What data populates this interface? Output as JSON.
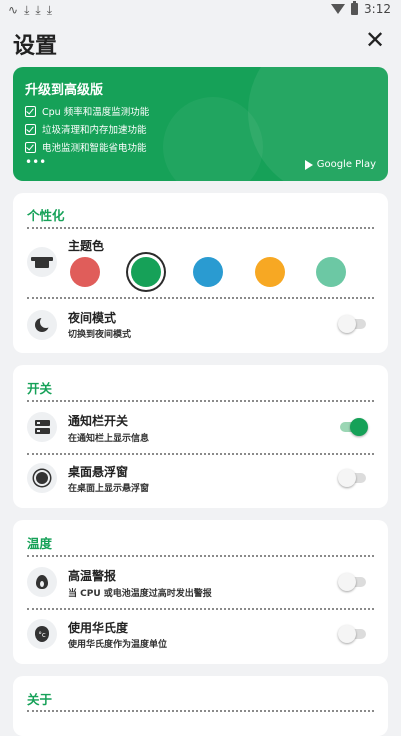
{
  "status_bar": {
    "time": "3:12"
  },
  "header": {
    "title": "设置",
    "close_label": "✕"
  },
  "promo": {
    "title": "升级到高级版",
    "features": [
      "Cpu 频率和温度监测功能",
      "垃圾清理和内存加速功能",
      "电池监测和智能省电功能"
    ],
    "more": "•••",
    "store": "Google Play"
  },
  "personalization": {
    "title": "个性化",
    "theme": {
      "label": "主题色",
      "colors": [
        "#e05d5a",
        "#16a158",
        "#2a9bd1",
        "#f7a823",
        "#6cc8a4"
      ],
      "selected_index": 1
    },
    "night_mode": {
      "title": "夜间模式",
      "subtitle": "切换到夜间模式",
      "on": false
    }
  },
  "switches": {
    "title": "开关",
    "notification": {
      "title": "通知栏开关",
      "subtitle": "在通知栏上显示信息",
      "on": true
    },
    "floating": {
      "title": "桌面悬浮窗",
      "subtitle": "在桌面上显示悬浮窗",
      "on": false
    }
  },
  "temperature": {
    "title": "温度",
    "high_alert": {
      "title": "高温警报",
      "subtitle": "当 CPU 或电池温度过高时发出警报",
      "on": false
    },
    "fahrenheit": {
      "title": "使用华氏度",
      "subtitle": "使用华氏度作为温度单位",
      "on": false
    }
  },
  "about": {
    "title": "关于"
  }
}
